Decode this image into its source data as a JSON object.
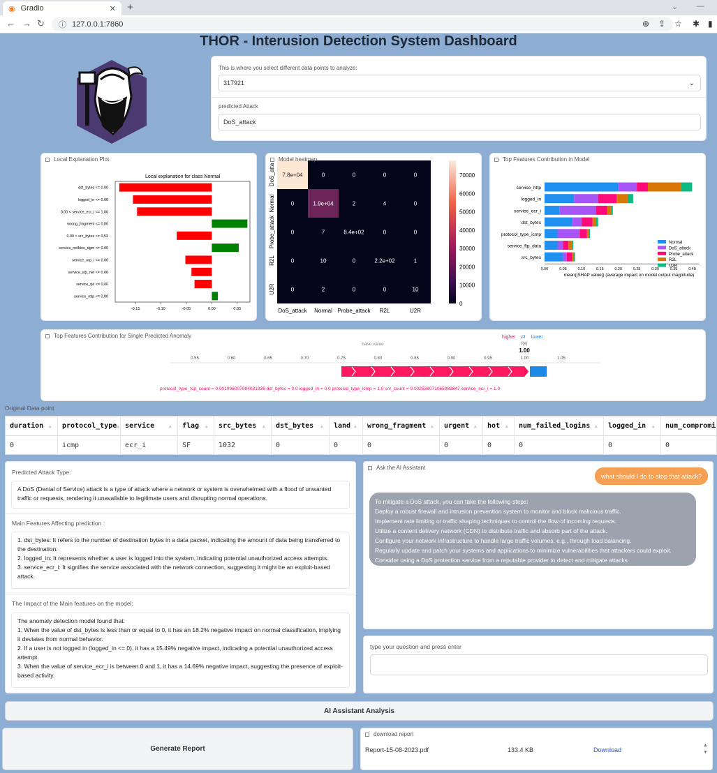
{
  "browser": {
    "tab_title": "Gradio",
    "url": "127.0.0.1:7860"
  },
  "page_title": "THOR - Interusion Detection System Dashboard",
  "selector": {
    "label": "This is where you select different data points to analyze:",
    "value": "317921",
    "predicted_label": "predicted Attack",
    "predicted_value": "DoS_attack"
  },
  "local_plot": {
    "label": "Local Explanation Plot",
    "chart_data": {
      "type": "bar",
      "title": "Local explanation for class Normal",
      "categories": [
        "dst_bytes <= 0.00",
        "logged_in <= 0.00",
        "0.00 < service_ecr_i <= 1.00",
        "wrong_fragment <= 0.00",
        "0.00 < src_bytes <= 0.52",
        "service_netbios_dgm <= 0.00",
        "service_urp_i <= 0.00",
        "service_sql_net <= 0.00",
        "service_rje <= 0.00",
        "service_mtp <= 0.00"
      ],
      "values": [
        -0.182,
        -0.155,
        -0.147,
        0.07,
        -0.069,
        0.053,
        -0.052,
        -0.04,
        -0.034,
        0.012
      ],
      "colors": {
        "negative": "#ff0000",
        "positive": "#008000"
      },
      "xlim": [
        -0.19,
        0.075
      ],
      "xticks": [
        "-0.15",
        "-0.10",
        "-0.05",
        "0.00",
        "0.05"
      ]
    }
  },
  "heatmap": {
    "label": "Model heatmap",
    "chart_data": {
      "type": "heatmap",
      "xlabels": [
        "DoS_attack",
        "Normal",
        "Probe_attack",
        "R2L",
        "U2R"
      ],
      "ylabels": [
        "DoS_atta",
        "Normal",
        "Probe_attack",
        "R2L",
        "U2R"
      ],
      "cells": [
        [
          "7.8e+04",
          "0",
          "0",
          "0",
          "0"
        ],
        [
          "0",
          "1.9e+04",
          "2",
          "4",
          "0"
        ],
        [
          "0",
          "7",
          "8.4e+02",
          "0",
          "0"
        ],
        [
          "0",
          "10",
          "0",
          "2.2e+02",
          "1"
        ],
        [
          "0",
          "2",
          "0",
          "0",
          "10"
        ]
      ],
      "values": [
        [
          78000,
          0,
          0,
          0,
          0
        ],
        [
          0,
          19000,
          2,
          4,
          0
        ],
        [
          0,
          7,
          840,
          0,
          0
        ],
        [
          0,
          10,
          0,
          220,
          1
        ],
        [
          0,
          2,
          0,
          0,
          10
        ]
      ],
      "colorbar": [
        "70000",
        "60000",
        "50000",
        "40000",
        "30000",
        "20000",
        "10000",
        "0"
      ]
    }
  },
  "top_features": {
    "label": "Top Features Contribution in Model",
    "chart_data": {
      "type": "bar",
      "stacked": true,
      "categories": [
        "service_http",
        "logged_in",
        "service_ecr_i",
        "dst_bytes",
        "protocol_type_icmp",
        "service_ftp_data",
        "src_bytes"
      ],
      "series": [
        {
          "name": "Normal",
          "color": "#1f8ff0",
          "values": [
            0.2,
            0.08,
            0.04,
            0.075,
            0.035,
            0.035,
            0.05
          ]
        },
        {
          "name": "DoS_attack",
          "color": "#a855f7",
          "values": [
            0.05,
            0.065,
            0.1,
            0.025,
            0.06,
            0.015,
            0.01
          ]
        },
        {
          "name": "Probe_attack",
          "color": "#ff0a78",
          "values": [
            0.03,
            0.05,
            0.03,
            0.03,
            0.02,
            0.015,
            0.015
          ]
        },
        {
          "name": "R2L",
          "color": "#d97706",
          "values": [
            0.09,
            0.03,
            0.01,
            0.01,
            0.005,
            0.01,
            0.005
          ]
        },
        {
          "name": "U2R",
          "color": "#10b981",
          "values": [
            0.03,
            0.015,
            0.005,
            0.005,
            0.003,
            0.003,
            0.003
          ]
        }
      ],
      "xlabel": "mean(|SHAP value|) (average impact on model output magnitude)",
      "xticks": [
        "0.00",
        "0.05",
        "0.10",
        "0.15",
        "0.20",
        "0.25",
        "0.30",
        "0.35",
        "0.40"
      ],
      "xlim": [
        0,
        0.42
      ]
    }
  },
  "force_plot": {
    "label": "Top Features Contribution for Single Predicted Anomaly",
    "higher": "higher",
    "arrows": "⇄",
    "lower": "lower",
    "base_value": "base value",
    "fx": "f(x)",
    "fx_value": "1.00",
    "ticks": [
      "0.55",
      "0.60",
      "0.65",
      "0.70",
      "0.75",
      "0.80",
      "0.85",
      "0.90",
      "0.95",
      "1.00",
      "1.05"
    ],
    "features": "protocol_type_tcp_count = 0.001996007984031936  dst_bytes = 0.0  logged_in = 0.0  protocol_type_icmp = 1.0  srv_count = 0.002538071065989847  service_ecr_i = 1.0"
  },
  "original": {
    "label": "Original Data point",
    "columns": [
      "duration",
      "protocol_type",
      "service",
      "flag",
      "src_bytes",
      "dst_bytes",
      "land",
      "wrong_fragment",
      "urgent",
      "hot",
      "num_failed_logins",
      "logged_in",
      "num_compromi"
    ],
    "row": [
      "0",
      "icmp",
      "ecr_i",
      "SF",
      "1032",
      "0",
      "0",
      "0",
      "0",
      "0",
      "0",
      "0",
      "0"
    ]
  },
  "predicted_attack": {
    "label": "Predicted Attack Type:",
    "text": "A DoS (Denial of Service) attack is a type of attack where a network or system is overwhelmed with a flood of unwanted traffic or requests, rendering it unavailable to legitimate users and disrupting normal operations."
  },
  "main_features": {
    "label": "Main Features Affecting prediction :",
    "lines": [
      "1. dst_bytes: It refers to the number of destination bytes in a data packet, indicating the amount of data being transferred to the destination.",
      "2. logged_in: It represents whether a user is logged into the system, indicating potential unauthorized access attempts.",
      "3. service_ecr_i: It signifies the service associated with the network connection, suggesting it might be an exploit-based attack."
    ]
  },
  "impact": {
    "label": "The Impact of the Main features on the model:",
    "lines": [
      "The anomaly detection model found that:",
      "1. When the value of dst_bytes is less than or equal to 0, it has an 18.2% negative impact on normal classification, implying it deviates from normal behavior.",
      "2. If a user is not logged in (logged_in <= 0), it has a 15.49% negative impact, indicating a potential unauthorized access attempt.",
      "3. When the value of service_ecr_i is between 0 and 1, it has a 14.69% negative impact, suggesting the presence of exploit-based activity."
    ]
  },
  "chat": {
    "label": "Ask the AI Assistant",
    "user_msg": "what should I do to stop that attack?",
    "assistant_lines": [
      "To mitigate a DoS attack, you can take the following steps:",
      "Deploy a robust firewall and intrusion prevention system to monitor and block malicious traffic.",
      "Implement rate limiting or traffic shaping techniques to control the flow of incoming requests.",
      "Utilize a content delivery network (CDN) to distribute traffic and absorb part of the attack.",
      "Configure your network infrastructure to handle large traffic volumes, e.g., through load balancing.",
      "Regularly update and patch your systems and applications to minimize vulnerabilities that attackers could exploit.",
      "Consider using a DoS protection service from a reputable provider to detect and mitigate attacks."
    ],
    "input_label": "type your question and press enter"
  },
  "buttons": {
    "analysis": "AI Assistant Analysis",
    "report": "Generate Report"
  },
  "download": {
    "label": "download report",
    "filename": "Report-15-08-2023.pdf",
    "size": "133.4 KB",
    "link": "Download"
  }
}
